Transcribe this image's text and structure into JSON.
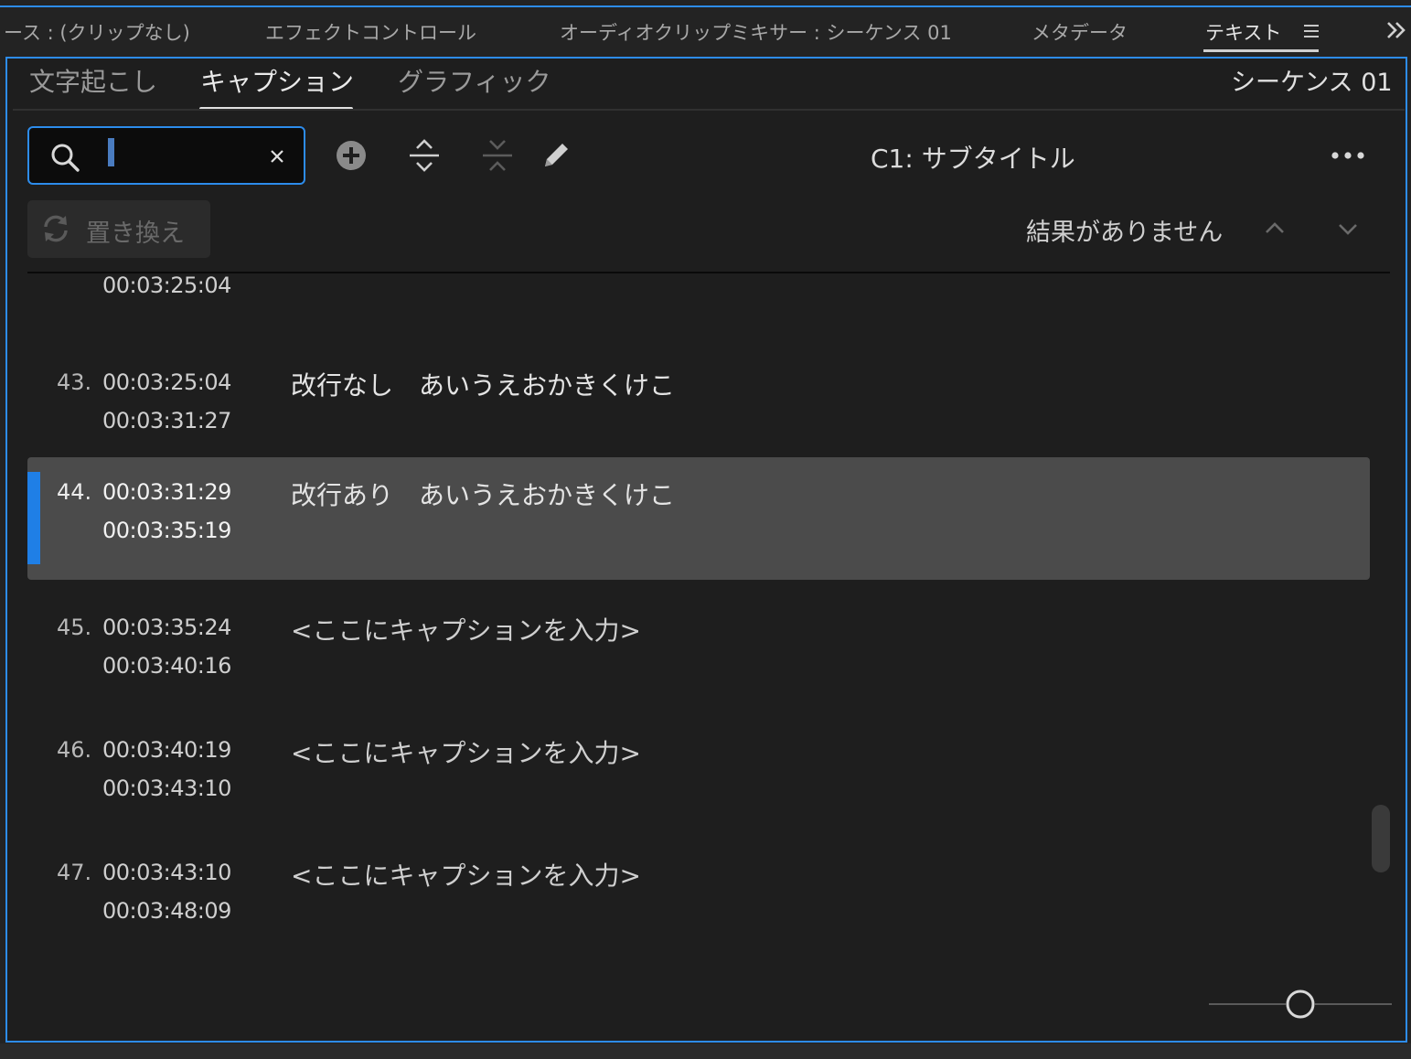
{
  "panel_tabs": [
    {
      "label": "ース : (クリップなし)"
    },
    {
      "label": "エフェクトコントロール"
    },
    {
      "label": "オーディオクリップミキサー : シーケンス 01"
    },
    {
      "label": "メタデータ"
    },
    {
      "label": "テキスト"
    }
  ],
  "panel_menu_icon": "hamburger-menu-icon",
  "panel_overflow_icon": "double-chevron-right-icon",
  "sub_tabs": [
    {
      "label": "文字起こし"
    },
    {
      "label": "キャプション",
      "active": true
    },
    {
      "label": "グラフィック"
    }
  ],
  "sequence_name": "シーケンス 01",
  "search": {
    "value": "",
    "placeholder": ""
  },
  "toolbar": {
    "icons": [
      "add-caption-icon",
      "split-caption-icon",
      "merge-caption-icon",
      "edit-pencil-icon"
    ],
    "track_label": "C1: サブタイトル",
    "more_icon": "more-options-icon"
  },
  "replace": {
    "label": "置き換え",
    "disabled": true
  },
  "results": {
    "text": "結果がありません"
  },
  "captions": {
    "partial_end_time": "00:03:25:04",
    "rows": [
      {
        "num": "43.",
        "start": "00:03:25:04",
        "end": "00:03:31:27",
        "text": "改行なし　あいうえおかきくけこ",
        "selected": false
      },
      {
        "num": "44.",
        "start": "00:03:31:29",
        "end": "00:03:35:19",
        "text": "改行あり　あいうえおかきくけこ",
        "selected": true
      },
      {
        "num": "45.",
        "start": "00:03:35:24",
        "end": "00:03:40:16",
        "text": "<ここにキャプションを入力>",
        "selected": false
      },
      {
        "num": "46.",
        "start": "00:03:40:19",
        "end": "00:03:43:10",
        "text": "<ここにキャプションを入力>",
        "selected": false
      },
      {
        "num": "47.",
        "start": "00:03:43:10",
        "end": "00:03:48:09",
        "text": "<ここにキャプションを入力>",
        "selected": false
      }
    ]
  },
  "colors": {
    "accent": "#2d8ceb",
    "selection": "#4b4b4b",
    "selection_marker": "#1f7fe6",
    "background": "#1e1e1e"
  }
}
